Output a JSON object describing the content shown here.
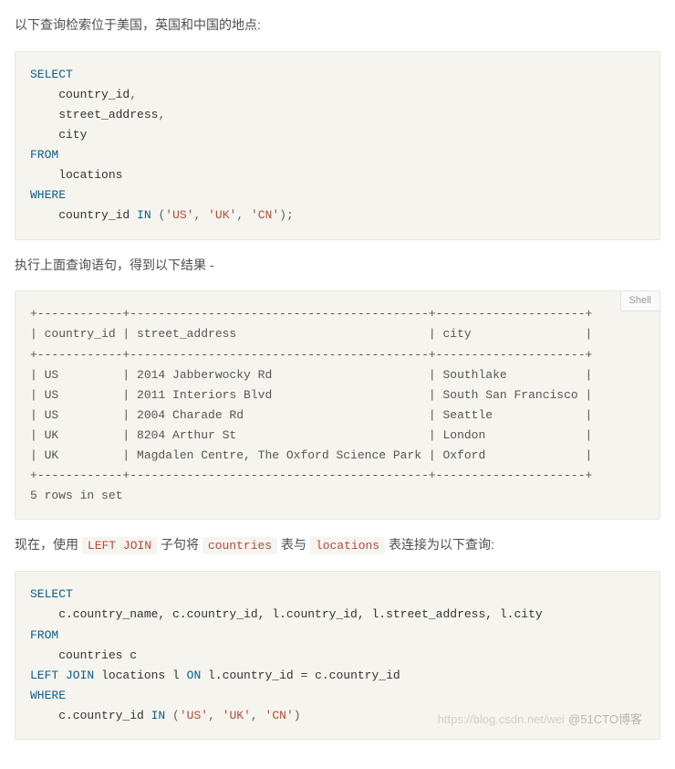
{
  "para1": "以下查询检索位于美国，英国和中国的地点:",
  "code1": {
    "select": "SELECT",
    "col1": "    country_id",
    "col2": "    street_address",
    "col3": "    city",
    "from": "FROM",
    "table": "    locations",
    "where": "WHERE",
    "cond_pre": "    country_id ",
    "in": "IN",
    "vals": " ('US', 'UK', 'CN');",
    "v1": "'US'",
    "v2": "'UK'",
    "v3": "'CN'"
  },
  "para2": "执行上面查询语句，得到以下结果 -",
  "badge_shell": "Shell",
  "table_out": "+------------+------------------------------------------+---------------------+\n| country_id | street_address                           | city                |\n+------------+------------------------------------------+---------------------+\n| US         | 2014 Jabberwocky Rd                      | Southlake           |\n| US         | 2011 Interiors Blvd                      | South San Francisco |\n| US         | 2004 Charade Rd                          | Seattle             |\n| UK         | 8204 Arthur St                           | London              |\n| UK         | Magdalen Centre, The Oxford Science Park | Oxford              |\n+------------+------------------------------------------+---------------------+\n5 rows in set",
  "para3_pre": "现在，使用 ",
  "para3_c1": "LEFT JOIN",
  "para3_mid1": " 子句将 ",
  "para3_c2": "countries",
  "para3_mid2": " 表与 ",
  "para3_c3": "locations",
  "para3_post": " 表连接为以下查询:",
  "code2": {
    "select": "SELECT",
    "cols": "    c.country_name, c.country_id, l.country_id, l.street_address, l.city",
    "from": "FROM",
    "table": "    countries c",
    "leftjoin": "LEFT JOIN",
    "join_rest": " locations l ",
    "on": "ON",
    "on_cond": " l.country_id = c.country_id",
    "where": "WHERE",
    "cond_pre": "    c.country_id ",
    "in": "IN",
    "v1": "'US'",
    "v2": "'UK'",
    "v3": "'CN'"
  },
  "watermark_light": "https://blog.csdn.net/wei",
  "watermark": "@51CTO博客",
  "chart_data": {
    "type": "table",
    "columns": [
      "country_id",
      "street_address",
      "city"
    ],
    "rows": [
      [
        "US",
        "2014 Jabberwocky Rd",
        "Southlake"
      ],
      [
        "US",
        "2011 Interiors Blvd",
        "South San Francisco"
      ],
      [
        "US",
        "2004 Charade Rd",
        "Seattle"
      ],
      [
        "UK",
        "8204 Arthur St",
        "London"
      ],
      [
        "UK",
        "Magdalen Centre, The Oxford Science Park",
        "Oxford"
      ]
    ],
    "footer": "5 rows in set"
  }
}
